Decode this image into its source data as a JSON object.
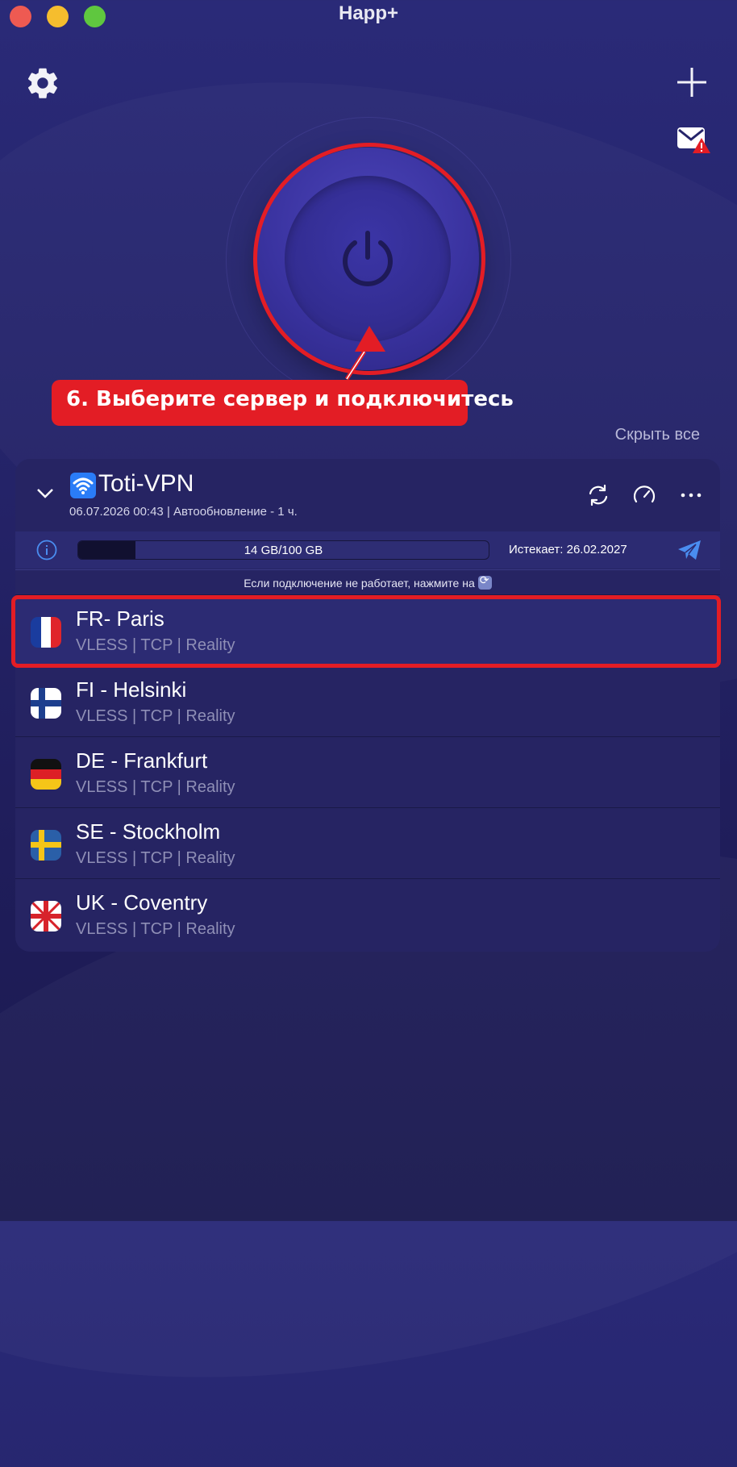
{
  "window": {
    "title": "Happ+"
  },
  "toolbar": {
    "settings_icon": "gear-icon",
    "add_icon": "plus-icon",
    "mail_icon": "mail-alert-icon"
  },
  "power_button": {
    "icon": "power-icon",
    "state": "disconnected"
  },
  "callout": {
    "text": "6. Выберите сервер и подключитесь",
    "color": "#e31d25"
  },
  "list_controls": {
    "hide_all": "Скрыть все"
  },
  "subscription": {
    "name": "Toti-VPN",
    "meta": "06.07.2026 00:43 | Автообновление - 1 ч.",
    "traffic": {
      "label": "14 GB/100 GB",
      "used_fraction": 0.14
    },
    "expires": "Истекает: 26.02.2027",
    "hint": "Если подключение не работает, нажмите на"
  },
  "servers": [
    {
      "name": "FR- Paris",
      "protocol": "VLESS | TCP | Reality",
      "flag": "france-flag-icon",
      "selected": true
    },
    {
      "name": "FI - Helsinki",
      "protocol": "VLESS | TCP | Reality",
      "flag": "finland-flag-icon",
      "selected": false
    },
    {
      "name": "DE - Frankfurt",
      "protocol": "VLESS | TCP | Reality",
      "flag": "germany-flag-icon",
      "selected": false
    },
    {
      "name": "SE - Stockholm",
      "protocol": "VLESS | TCP | Reality",
      "flag": "sweden-flag-icon",
      "selected": false
    },
    {
      "name": "UK - Coventry",
      "protocol": "VLESS | TCP | Reality",
      "flag": "uk-flag-icon",
      "selected": false
    }
  ],
  "colors": {
    "accent_red": "#e31d25",
    "background": "#25246a",
    "card": "#262463",
    "active_row": "#2c2b73",
    "telegram": "#4a8df0"
  }
}
